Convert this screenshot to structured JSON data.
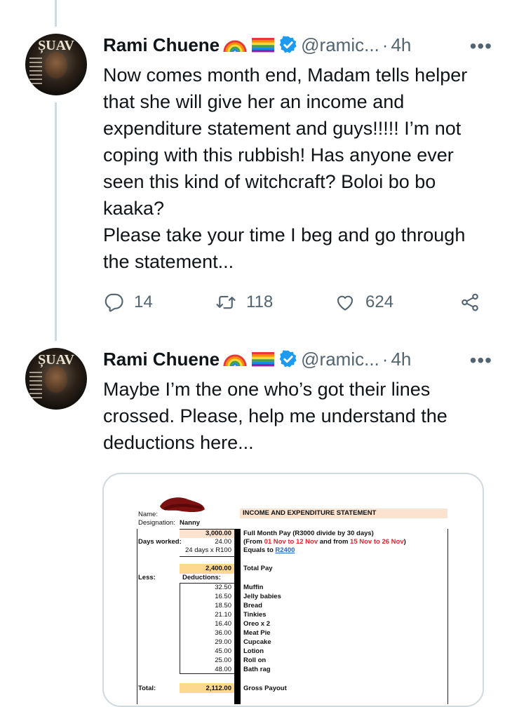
{
  "tweets": [
    {
      "name": "Rami Chuene",
      "handle": "@ramic...",
      "separator": "·",
      "time": "4h",
      "more": "•••",
      "text": "Now comes month end, Madam tells helper that she will give her an income and expenditure statement and guys!!!!! I’m not coping with this rubbish! Has anyone ever seen this kind of witchcraft? Boloi bo bo kaaka?\nPlease take your time I beg and go through the statement...",
      "replies": "14",
      "retweets": "118",
      "likes": "624"
    },
    {
      "name": "Rami Chuene",
      "handle": "@ramic...",
      "separator": "·",
      "time": "4h",
      "more": "•••",
      "text": "Maybe I’m the one who’s got their lines crossed. Please, help me understand the deductions here..."
    }
  ],
  "icons": {
    "emoji_1": "rainbow",
    "emoji_2": "rainbow-flag",
    "verified": "verified-badge",
    "reply": "reply-icon",
    "retweet": "retweet-icon",
    "like": "heart-icon",
    "share": "share-icon"
  },
  "colors": {
    "verified_blue": "#1d9bf0",
    "muted": "#536471",
    "thread_line": "#cfd9de"
  },
  "statement": {
    "name_label": "Name:",
    "designation_label": "Designation:",
    "designation_value": "Nanny",
    "title": "INCOME AND EXPENDITURE STATEMENT",
    "full_pay": "3,000.00",
    "full_pay_desc": "Full Month Pay (R3000 divide by 30 days)",
    "days_worked_label": "Days worked:",
    "days_worked": "24.00",
    "dates_prefix": "(From ",
    "date_range_1": "01 Nov to 12 Nov",
    "dates_middle": " and from ",
    "date_range_2": "15 Nov to 26 Nov",
    "dates_suffix": ")",
    "rate": "24 days x R100",
    "equals_label": "Equals to ",
    "equals_value": "R2400",
    "total_pay": "2,400.00",
    "total_pay_label": "Total Pay",
    "less_label": "Less:",
    "deductions_label": "Deductions:",
    "deductions": [
      {
        "amount": "32.50",
        "item": "Muffin"
      },
      {
        "amount": "16.50",
        "item": "Jelly babies"
      },
      {
        "amount": "18.50",
        "item": "Bread"
      },
      {
        "amount": "21.10",
        "item": "Tinkies"
      },
      {
        "amount": "16.40",
        "item": "Oreo x 2"
      },
      {
        "amount": "36.00",
        "item": "Meat Pie"
      },
      {
        "amount": "29.00",
        "item": "Cupcake"
      },
      {
        "amount": "45.00",
        "item": "Lotion"
      },
      {
        "amount": "25.00",
        "item": "Roll on"
      },
      {
        "amount": "48.00",
        "item": "Bath rag"
      }
    ],
    "total_label": "Total:",
    "gross": "2,112.00",
    "gross_label": "Gross Payout"
  }
}
